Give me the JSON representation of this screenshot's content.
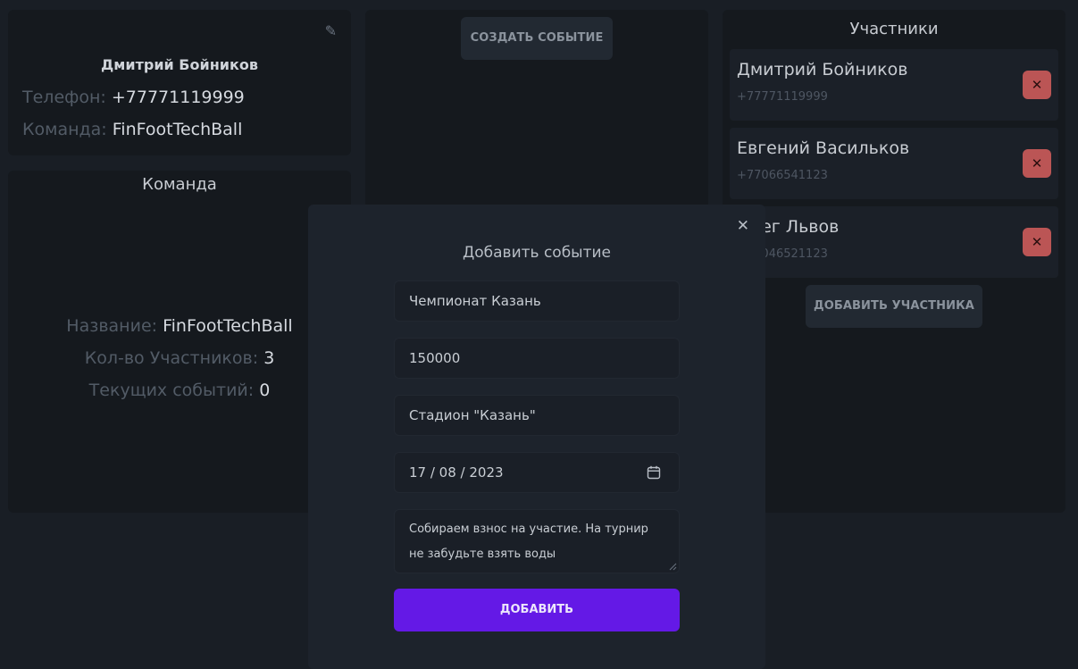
{
  "profile": {
    "name": "Дмитрий Бойников",
    "phone_label": "Телефон:",
    "phone": "+77771119999",
    "team_label": "Команда:",
    "team": "FinFootTechBall"
  },
  "team_panel": {
    "title": "Команда",
    "name_label": "Название:",
    "name": "FinFootTechBall",
    "members_label": "Кол-во Участников:",
    "members_count": "3",
    "events_label": "Текущих событий:",
    "events_count": "0"
  },
  "events_panel": {
    "create_button": "СОЗДАТЬ СОБЫТИЕ"
  },
  "members_panel": {
    "title": "Участники",
    "members": [
      {
        "name": "Дмитрий Бойников",
        "phone": "+77771119999"
      },
      {
        "name": "Евгений Васильков",
        "phone": "+77066541123"
      },
      {
        "name": "Олег Львов",
        "phone": "+77046521123"
      }
    ],
    "remove_symbol": "✕",
    "add_button": "ДОБАВИТЬ УЧАСТНИКА"
  },
  "modal": {
    "close_symbol": "✕",
    "title": "Добавить событие",
    "event_name": "Чемпионат Казань",
    "amount": "150000",
    "location": "Стадион \"Казань\"",
    "date": "17 / 08 / 2023",
    "description": "Собираем взнос на участие. На турнир не забудьте взять воды",
    "submit": "ДОБАВИТЬ"
  },
  "colors": {
    "background": "#191e25",
    "panel": "#15191e",
    "modal": "#1d232c",
    "primary": "#6419e6",
    "danger": "#bb5555"
  }
}
